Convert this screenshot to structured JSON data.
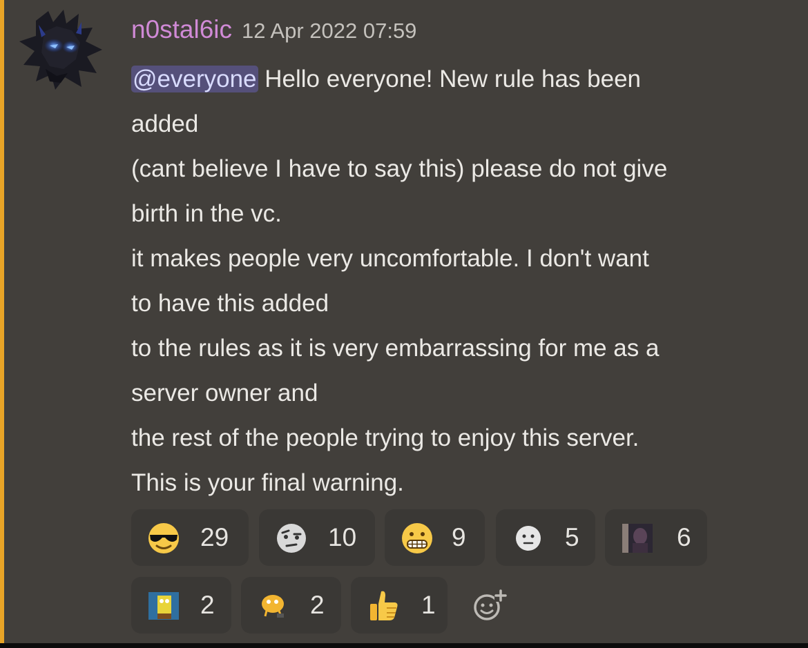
{
  "message": {
    "author": "n0stal6ic",
    "timestamp": "12 Apr 2022 07:59",
    "mention": "@everyone",
    "first_line_rest": " Hello everyone! New rule has been",
    "lines": [
      "added",
      "(cant believe I have to say this) please do not give",
      "birth in the vc.",
      "it makes people very uncomfortable. I don't want",
      "to have this added",
      "to the rules as it is very embarrassing for me as a",
      "server owner and",
      "the rest of the people trying to enjoy this server.",
      "This is your final warning."
    ]
  },
  "reactions": [
    {
      "emoji": "sunglasses-face",
      "count": "29"
    },
    {
      "emoji": "face-with-raised-eyebrow",
      "count": "10"
    },
    {
      "emoji": "grimacing-face",
      "count": "9"
    },
    {
      "emoji": "neutral-face",
      "count": "5"
    },
    {
      "emoji": "custom-image",
      "count": "6"
    },
    {
      "emoji": "custom-spongebob",
      "count": "2"
    },
    {
      "emoji": "custom-cartoon",
      "count": "2"
    },
    {
      "emoji": "thumbs-up",
      "count": "1"
    }
  ],
  "colors": {
    "background": "#423f3b",
    "mention_bar": "#e8a427",
    "username": "#d08ad6",
    "mention_bg": "#55507a",
    "reaction_bg": "#3a3835"
  },
  "icons": {
    "add_reaction": "add-reaction-icon"
  }
}
